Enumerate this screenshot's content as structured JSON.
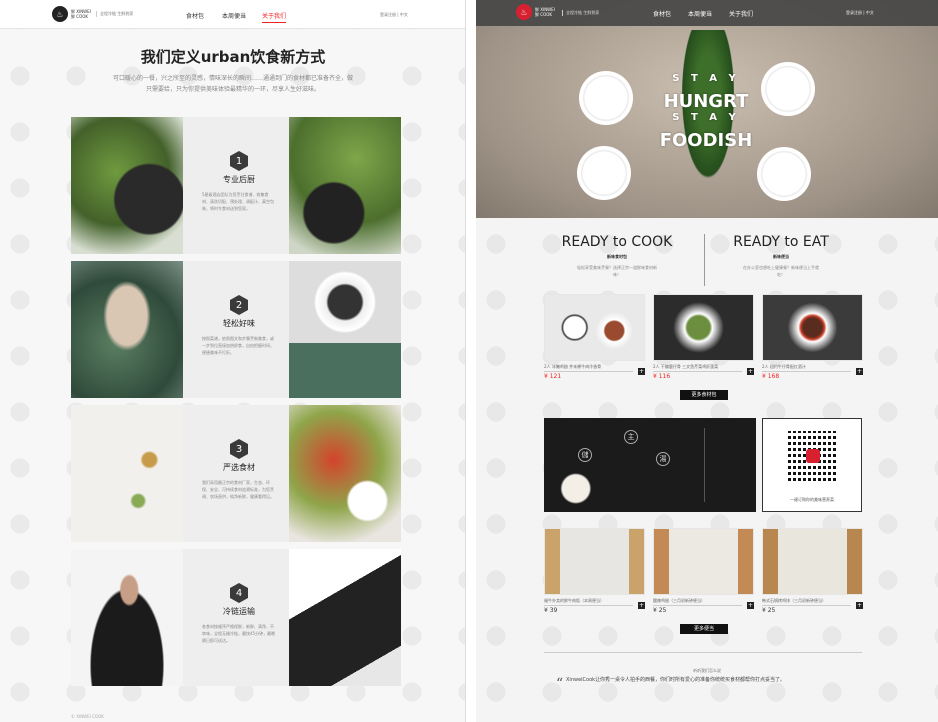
{
  "left": {
    "logo": {
      "icon": "chef-hat-icon",
      "lines": [
        "鲜 XINWEI",
        "鲜 COOK"
      ]
    },
    "slogan": "全程冷链  生鲜到家",
    "nav": [
      "食材包",
      "本周便当",
      "关于我们"
    ],
    "active_nav": "关于我们",
    "right_links": "登录注册  |  中文",
    "title": "我们定义urban饮食新方式",
    "intro": "可口暖心的一餐，兴之所至的灵感，情味深长的瞬间……通通到门的食材都已准备齐全，做只需要给，只为你提供美味体验最精华的一环，尽享人生好滋味。",
    "features": [
      {
        "num": "1",
        "title": "专业后厨",
        "desc": "5星级酒店团队为您烹饪食谱、收集食材、清洗切配、预处理、调配汁、真空包装，将时令食材送到您家。"
      },
      {
        "num": "2",
        "title": "轻松好味",
        "desc": "按照菜谱，依照图文和步骤烹制美食，或一步到位直接加热即食，自由把握时间，便捷美味不打折。"
      },
      {
        "num": "3",
        "title": "严选食材",
        "desc": "我们采用最正宗的食材厂家，生态、环保、安全、可持续食材追溯标准，为您烹调、农场直供，纯净新鲜，健康看得见。"
      },
      {
        "num": "4",
        "title": "冷链运输",
        "desc": "各食材按顺序严格保鲜，新鲜、清净、不串味，全程无缝冷链，最快45分钟，最晚隔日即可送达。"
      }
    ],
    "footer": "© XINWEI COOK"
  },
  "right": {
    "logo": {
      "icon": "chef-hat-icon",
      "lines": [
        "鲜 XINWEI",
        "鲜 COOK"
      ]
    },
    "slogan": "全程冷链  生鲜到家",
    "nav": [
      "食材包",
      "本周便当",
      "关于我们"
    ],
    "right_links": "登录注册  |  中文",
    "hero_text": [
      "S T A Y",
      "HUNGRT",
      "S T A Y",
      "FOODISH"
    ],
    "ready_cook": {
      "title": "READY to COOK",
      "sub": "新味食材包",
      "desc": "轻松享受美味烹餐？选择正宗一道鲜味食材新味！"
    },
    "ready_eat": {
      "title": "READY to EAT",
      "sub": "新味便当",
      "desc": "在办公室也想吃上健康餐？新味便当上手就吃！"
    },
    "kits": [
      {
        "name": "2人 冰腌鸡翅 芥末酱牛肉冷香骨",
        "price": "¥ 121"
      },
      {
        "name": "2人 干煸鹿仔骨 三文鱼芹菜鸡肝菠菜",
        "price": "¥ 116"
      },
      {
        "name": "2人 纽约牛仔骨配红酒汁",
        "price": "¥ 168"
      }
    ],
    "more_kits": "更多食材包",
    "banner_chars": [
      "儲",
      "主",
      "湯"
    ],
    "qr_caption": "一键订购你的美味营养菜",
    "bentos": [
      {
        "name": "福牛外卖的鲜牛肉饭（本周便当）",
        "price": "¥ 39"
      },
      {
        "name": "酸辣鸡翅（三月初新钟便当）",
        "price": "¥ 25"
      },
      {
        "name": "韩式石锅烤鸡排（三月初新钟便当）",
        "price": "¥ 25"
      }
    ],
    "more_bentos": "更多便当",
    "testimonial_label": "听听我们怎么说",
    "testimonial": "XinweiCook让你秀一桌令人拍手的西餐，你们时所有爱心的准备你统统买食材都帮你打点妥当了。"
  }
}
